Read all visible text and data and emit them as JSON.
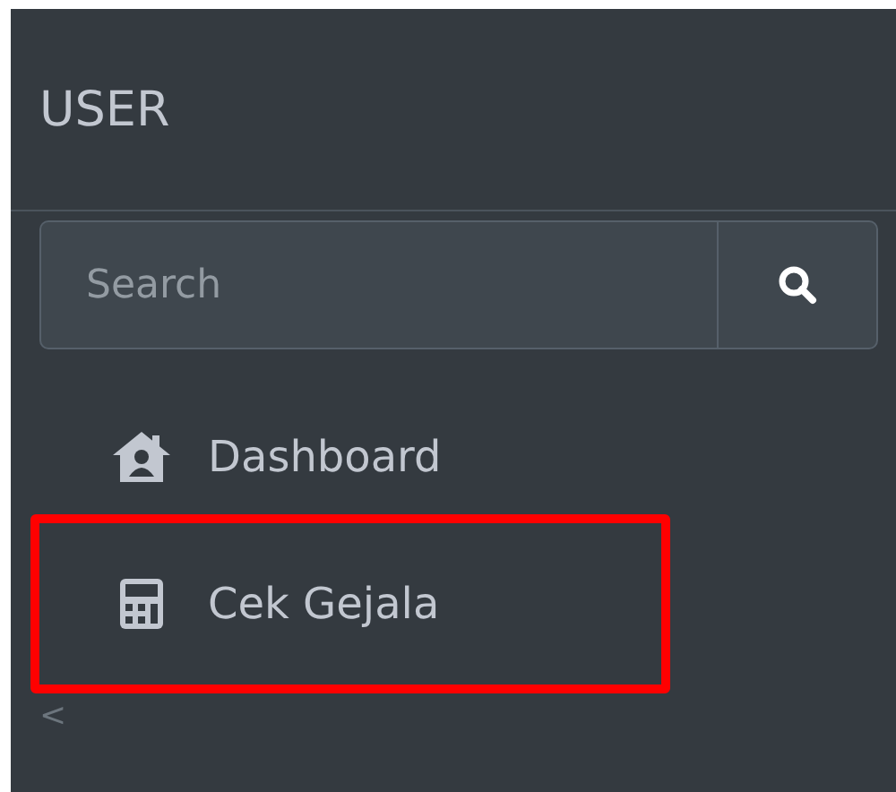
{
  "sidebar": {
    "user": "USER",
    "search": {
      "placeholder": "Search"
    },
    "items": [
      {
        "label": "Dashboard",
        "kind": "home",
        "highlighted": false
      },
      {
        "label": "Cek Gejala",
        "kind": "calculator",
        "highlighted": true
      }
    ],
    "collapse": "<"
  }
}
